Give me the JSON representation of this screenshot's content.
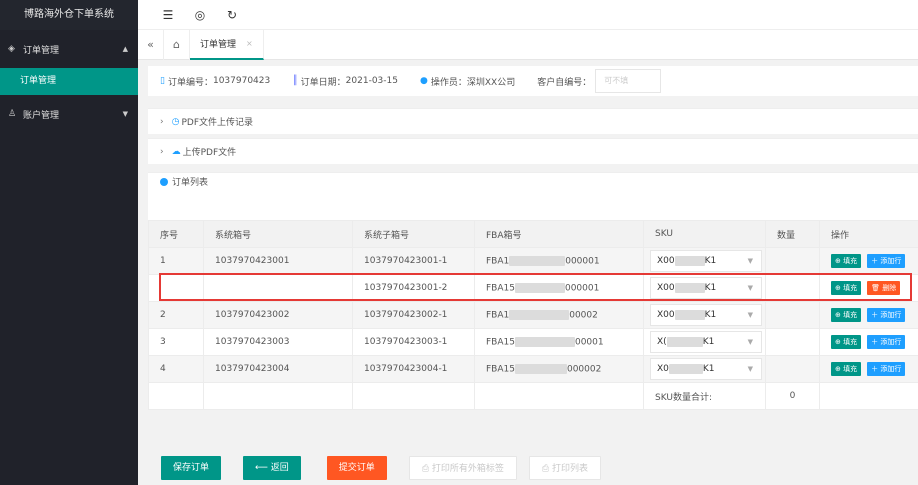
{
  "app": {
    "title": "博路海外仓下单系统"
  },
  "sidebar": {
    "groups": [
      {
        "label": "订单管理",
        "icon": "layers-icon"
      },
      {
        "label": "账户管理",
        "icon": "user-icon"
      }
    ],
    "active_item": "订单管理"
  },
  "topbar": {
    "icons": [
      "menu-fold-icon",
      "globe-icon",
      "refresh-icon"
    ]
  },
  "tabs": {
    "items": [
      {
        "label": "订单管理",
        "close": "×"
      }
    ]
  },
  "order_info": {
    "order_no_label": "订单编号：",
    "order_no": "1037970423",
    "order_date_label": "订单日期：",
    "order_date": "2021-03-15",
    "operator_label": "操作员：",
    "operator": "深圳XX公司",
    "customer_no_label": "客户自编号：",
    "customer_no_placeholder": "可不填"
  },
  "sections": {
    "pdf_upload_log": "PDF文件上传记录",
    "upload_pdf": "上传PDF文件",
    "order_list": "订单列表"
  },
  "table": {
    "headers": [
      "序号",
      "系统箱号",
      "系统子箱号",
      "FBA箱号",
      "SKU",
      "数量",
      "操作"
    ],
    "rows": [
      {
        "seq": "1",
        "sys_box": "1037970423001",
        "sub_box": "1037970423001-1",
        "fba_pre": "FBA1",
        "fba_suf": "000001",
        "sku_pre": "X00",
        "sku_suf": "K1",
        "ops": [
          "填充",
          "添加行"
        ]
      },
      {
        "seq": "",
        "sys_box": "",
        "sub_box": "1037970423001-2",
        "fba_pre": "FBA15",
        "fba_suf": "000001",
        "sku_pre": "X00",
        "sku_suf": "K1",
        "ops": [
          "填充",
          "删除"
        ]
      },
      {
        "seq": "2",
        "sys_box": "1037970423002",
        "sub_box": "1037970423002-1",
        "fba_pre": "FBA1",
        "fba_suf": "00002",
        "sku_pre": "X00",
        "sku_suf": "K1",
        "ops": [
          "填充",
          "添加行"
        ]
      },
      {
        "seq": "3",
        "sys_box": "1037970423003",
        "sub_box": "1037970423003-1",
        "fba_pre": "FBA15",
        "fba_suf": "00001",
        "sku_pre": "X(",
        "sku_suf": "K1",
        "ops": [
          "填充",
          "添加行"
        ]
      },
      {
        "seq": "4",
        "sys_box": "1037970423004",
        "sub_box": "1037970423004-1",
        "fba_pre": "FBA15",
        "fba_suf": "000002",
        "sku_pre": "X0",
        "sku_suf": "K1",
        "ops": [
          "填充",
          "添加行"
        ]
      }
    ],
    "total_label": "SKU数量合计:",
    "total_value": "0"
  },
  "actions": {
    "save": "保存订单",
    "back": "返回",
    "submit": "提交订单",
    "print_labels": "打印所有外箱标签",
    "print_list": "打印列表"
  }
}
